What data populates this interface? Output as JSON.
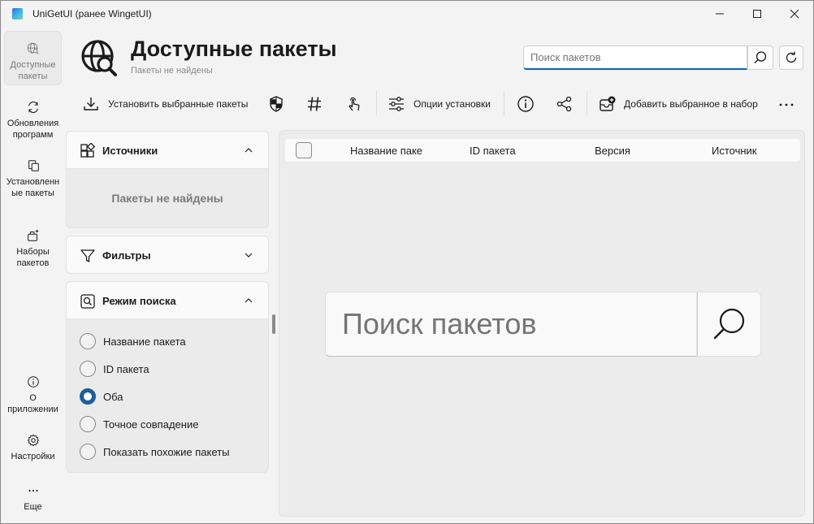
{
  "window": {
    "title": "UniGetUI (ранее WingetUI)"
  },
  "nav": {
    "items": [
      {
        "label": "Доступные пакеты",
        "icon": "globe-search-icon",
        "active": true
      },
      {
        "label": "Обновления программ",
        "icon": "refresh-icon"
      },
      {
        "label": "Установленные пакеты",
        "icon": "installed-icon"
      },
      {
        "label": "Наборы пакетов",
        "icon": "bundle-icon"
      },
      {
        "label": "О приложении",
        "icon": "info-icon"
      },
      {
        "label": "Настройки",
        "icon": "gear-icon"
      },
      {
        "label": "Еще",
        "icon": "more-icon"
      }
    ]
  },
  "header": {
    "title": "Доступные пакеты",
    "subtitle": "Пакеты не найдены",
    "search_placeholder": "Поиск пакетов"
  },
  "toolbar": {
    "install_selected": "Установить выбранные пакеты",
    "install_options": "Опции установки",
    "add_to_bundle": "Добавить выбранное в набор"
  },
  "sources": {
    "title": "Источники",
    "empty": "Пакеты не найдены"
  },
  "filters": {
    "title": "Фильтры"
  },
  "search_mode": {
    "title": "Режим поиска",
    "options": [
      {
        "label": "Название пакета",
        "checked": false
      },
      {
        "label": "ID пакета",
        "checked": false
      },
      {
        "label": "Оба",
        "checked": true
      },
      {
        "label": "Точное совпадение",
        "checked": false
      },
      {
        "label": "Показать похожие пакеты",
        "checked": false
      }
    ]
  },
  "table": {
    "columns": [
      "Название паке",
      "ID пакета",
      "Версия",
      "Источник"
    ]
  },
  "center_search": {
    "placeholder": "Поиск пакетов"
  },
  "colors": {
    "accent": "#0067c0",
    "radio_checked": "#1f5d9a"
  }
}
